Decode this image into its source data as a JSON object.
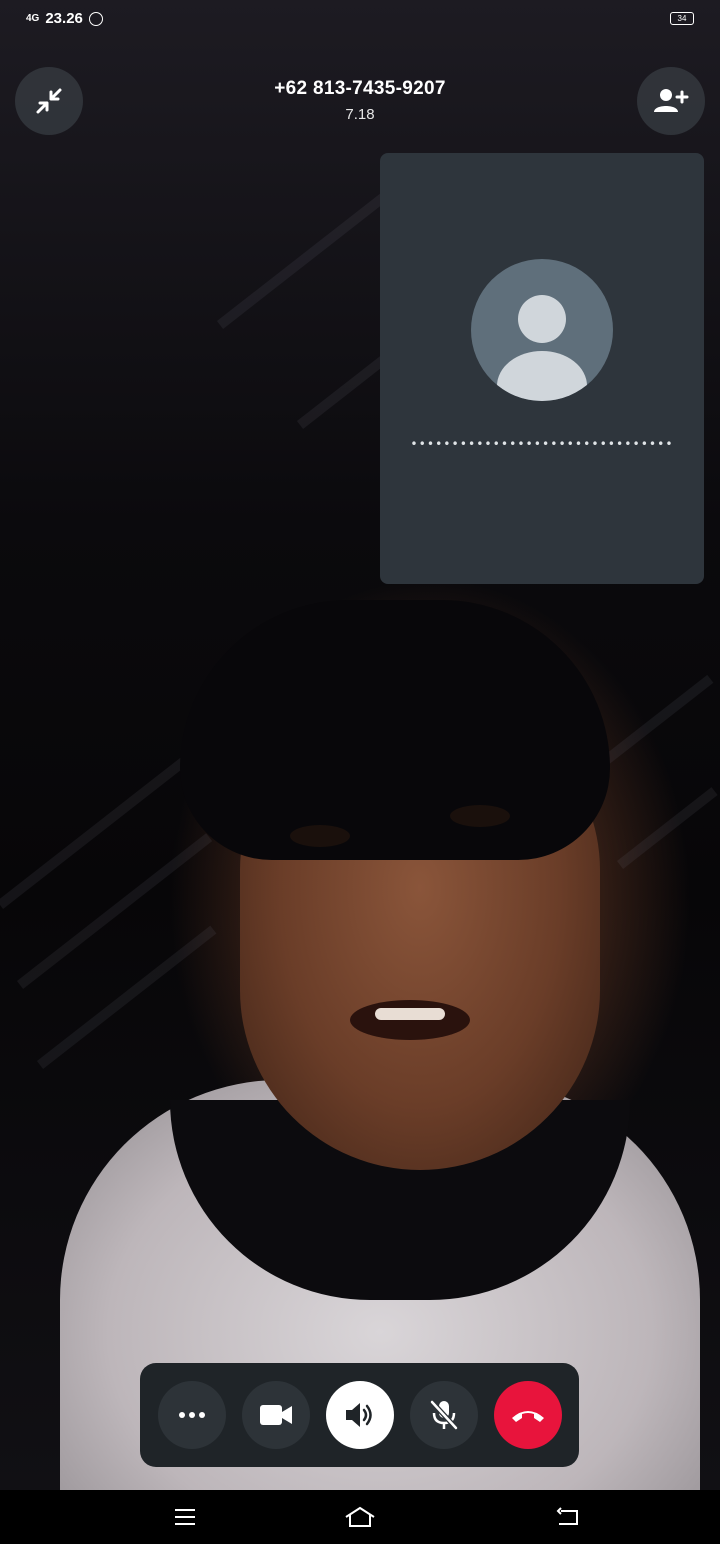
{
  "status_bar": {
    "network": "4G",
    "time": "23.26",
    "notification_icon": "whatsapp-icon",
    "battery_level": "34"
  },
  "call": {
    "caller": "+62 813-7435-9207",
    "duration": "7.18",
    "remote_status": "••••••••••••••••••••••••••••••••"
  },
  "header": {
    "minimize_icon": "minimize-arrows-icon",
    "add_participant_icon": "add-person-icon"
  },
  "controls": [
    {
      "name": "more-options-button",
      "icon": "more-horizontal-icon"
    },
    {
      "name": "video-button",
      "icon": "video-camera-icon"
    },
    {
      "name": "speaker-button",
      "icon": "speaker-icon",
      "active": true
    },
    {
      "name": "mute-button",
      "icon": "mic-off-icon"
    },
    {
      "name": "end-call-button",
      "icon": "end-call-icon",
      "color": "#e8143c"
    }
  ],
  "nav": {
    "menu_icon": "menu-icon",
    "home_icon": "home-icon",
    "back_icon": "back-icon"
  },
  "colors": {
    "end_call": "#e8143c",
    "tile_bg": "#2e353c",
    "control_bar": "#1f2428"
  }
}
